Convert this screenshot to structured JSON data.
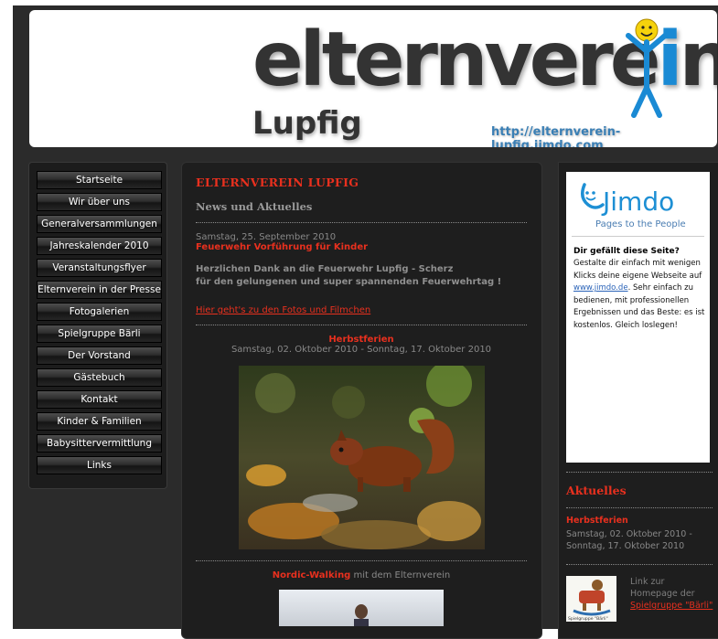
{
  "header": {
    "logo_main": "elternvere",
    "logo_i": "i",
    "logo_n": "n",
    "logo_sub": "Lupfig",
    "url": "http://elternverein-lupfig.jimdo.com"
  },
  "nav": {
    "items": [
      {
        "label": "Startseite"
      },
      {
        "label": "Wir über uns"
      },
      {
        "label": "Generalversammlungen"
      },
      {
        "label": "Jahreskalender 2010"
      },
      {
        "label": "Veranstaltungsflyer"
      },
      {
        "label": "Elternverein in der Presse"
      },
      {
        "label": "Fotogalerien"
      },
      {
        "label": "Spielgruppe Bärli"
      },
      {
        "label": "Der Vorstand"
      },
      {
        "label": "Gästebuch"
      },
      {
        "label": "Kontakt"
      },
      {
        "label": "Kinder & Familien"
      },
      {
        "label": "Babysittervermittlung"
      },
      {
        "label": "Links"
      }
    ]
  },
  "content": {
    "title": "ELTERNVEREIN LUPFIG",
    "subtitle": "News und Aktuelles",
    "post1": {
      "date": "Samstag, 25. September 2010",
      "headline": "Feuerwehr Vorführung für Kinder",
      "text_line1": "Herzlichen Dank an die Feuerwehr Lupfig - Scherz",
      "text_line2": "für den gelungenen und super spannenden Feuerwehrtag !",
      "link": "Hier geht's zu den Fotos und Filmchen"
    },
    "post2": {
      "headline": "Herbstferien",
      "dates": "Samstag, 02. Oktober 2010 - Sonntag, 17. Oktober 2010"
    },
    "post3": {
      "headline_red": "Nordic-Walking",
      "headline_rest": " mit dem Elternverein"
    }
  },
  "sidebar_right": {
    "ad": {
      "logo": "Jimdo",
      "tagline": "Pages to the People",
      "heading": "Dir gefällt diese Seite?",
      "body_1": "Gestalte dir einfach mit wenigen Klicks deine eigene Webseite auf ",
      "link": "www.jimdo.de",
      "body_2": ". Sehr einfach zu bedienen, mit professionellen Ergebnissen und das Beste: es ist kostenlos. Gleich loslegen!"
    },
    "aktuelles": {
      "title": "Aktuelles",
      "item_title": "Herbstferien",
      "item_dates": "Samstag, 02. Oktober 2010 - Sonntag, 17. Oktober 2010",
      "link_text_pre": "Link zur Homepage der ",
      "link_text": "Spielgruppe \"Bärli\"",
      "thumb_caption": "Spielgruppe \"Bärli\""
    }
  },
  "colors": {
    "accent_red": "#e8301e",
    "background": "#2b2b2b",
    "panel": "#1e1e1e",
    "link_blue": "#3a7fb5"
  }
}
